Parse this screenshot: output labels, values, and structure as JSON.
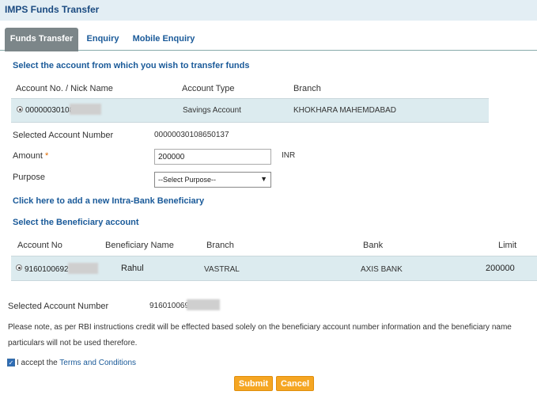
{
  "header": {
    "title": "IMPS Funds Transfer"
  },
  "tabs": [
    {
      "label": "Funds Transfer",
      "active": true
    },
    {
      "label": "Enquiry",
      "active": false
    },
    {
      "label": "Mobile Enquiry",
      "active": false
    }
  ],
  "source": {
    "prompt": "Select the account from which you wish to transfer funds",
    "columns": [
      "Account No. / Nick Name",
      "Account Type",
      "Branch"
    ],
    "row": {
      "account": "00000030108",
      "type": "Savings Account",
      "branch": "KHOKHARA MAHEMDABAD",
      "selected": true
    }
  },
  "form": {
    "selected_account_label": "Selected Account Number",
    "selected_account_value": "00000030108650137",
    "amount_label": "Amount",
    "amount_required_mark": "*",
    "amount_value": "200000",
    "currency": "INR",
    "purpose_label": "Purpose",
    "purpose_selected": "--Select Purpose--"
  },
  "add_beneficiary_link": "Click here to add a new Intra-Bank Beneficiary",
  "beneficiary": {
    "prompt": "Select the Beneficiary account",
    "columns": [
      "Account No",
      "Beneficiary Name",
      "Branch",
      "Bank",
      "Limit"
    ],
    "row": {
      "account": "9160100692",
      "name": "Rahul",
      "branch": "VASTRAL",
      "bank": "AXIS BANK",
      "limit": "200000",
      "selected": true
    }
  },
  "beneficiary_selected": {
    "label": "Selected Account Number",
    "value": "916010069"
  },
  "note": {
    "line1": "Please note, as per RBI instructions credit will be effected based solely on the beneficiary account number information and the beneficiary name",
    "line2": "particulars will not be used therefore."
  },
  "terms": {
    "prefix": "I accept the ",
    "link": "Terms and Conditions",
    "checked": true
  },
  "buttons": {
    "submit": "Submit",
    "cancel": "Cancel"
  },
  "colors": {
    "header_bg": "#e3eef4",
    "row_bg": "#dcebef",
    "link": "#1a5a99",
    "button": "#f5a623",
    "active_tab": "#7c8689"
  }
}
